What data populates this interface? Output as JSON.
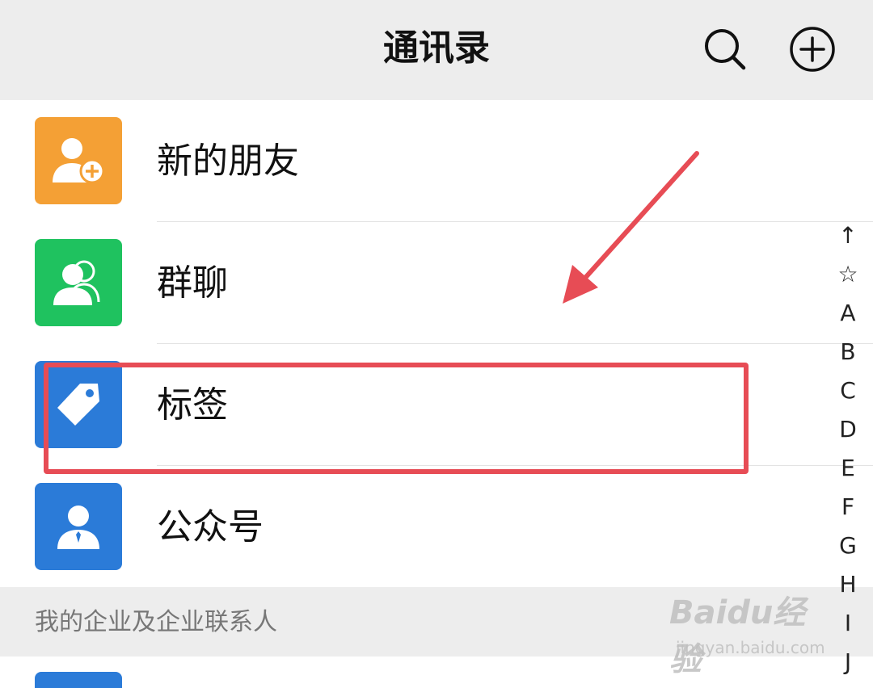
{
  "header": {
    "title": "通讯录"
  },
  "contacts_menu": [
    {
      "label": "新的朋友",
      "icon": "add-friend-icon",
      "color": "#f4a035"
    },
    {
      "label": "群聊",
      "icon": "group-chat-icon",
      "color": "#1fc25f"
    },
    {
      "label": "标签",
      "icon": "tag-icon",
      "color": "#2b7bd8"
    },
    {
      "label": "公众号",
      "icon": "official-account-icon",
      "color": "#2b7bd8"
    }
  ],
  "section": {
    "title": "我的企业及企业联系人"
  },
  "index_bar": [
    "↑",
    "☆",
    "A",
    "B",
    "C",
    "D",
    "E",
    "F",
    "G",
    "H",
    "I",
    "J"
  ],
  "watermark": {
    "brand": "Baidu经验",
    "url": "jingyan.baidu.com"
  },
  "annotation_color": "#e74c55"
}
